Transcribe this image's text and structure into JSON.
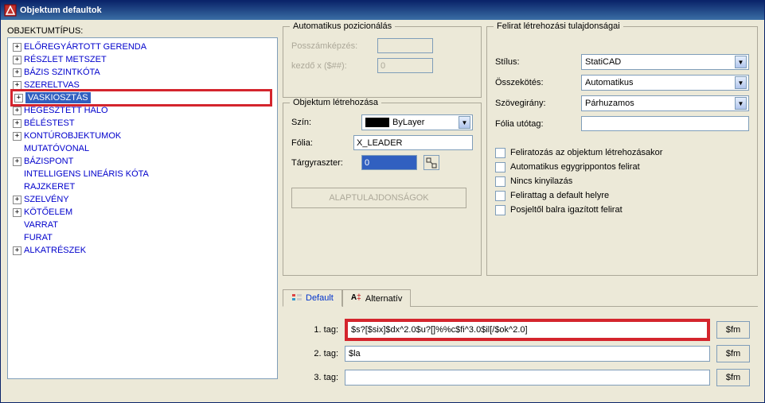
{
  "titlebar": {
    "text": "Objektum defaultok"
  },
  "left": {
    "heading": "OBJEKTUMTÍPUS:",
    "items": [
      {
        "plus": true,
        "label": "ELŐREGYÁRTOTT GERENDA"
      },
      {
        "plus": true,
        "label": "RÉSZLET METSZET"
      },
      {
        "plus": true,
        "label": "BÁZIS SZINTKÓTA"
      },
      {
        "plus": true,
        "label": "SZERELTVAS"
      },
      {
        "plus": true,
        "label": "VASKIOSZTÁS",
        "selected": true
      },
      {
        "plus": true,
        "label": "HEGESZTETT HÁLÓ"
      },
      {
        "plus": true,
        "label": "BÉLÉSTEST"
      },
      {
        "plus": true,
        "label": "KONTÚROBJEKTUMOK"
      },
      {
        "plus": false,
        "label": "MUTATÓVONAL"
      },
      {
        "plus": true,
        "label": "BÁZISPONT"
      },
      {
        "plus": false,
        "label": "INTELLIGENS LINEÁRIS KÓTA"
      },
      {
        "plus": false,
        "label": "RAJZKERET"
      },
      {
        "plus": true,
        "label": "SZELVÉNY"
      },
      {
        "plus": true,
        "label": "KÖTŐELEM"
      },
      {
        "plus": false,
        "label": "VARRAT"
      },
      {
        "plus": false,
        "label": "FURAT"
      },
      {
        "plus": true,
        "label": "ALKATRÉSZEK"
      }
    ]
  },
  "groups": {
    "autopos": {
      "legend": "Automatikus pozicionálás",
      "row1_label": "Posszámképzés:",
      "row1_value": "",
      "row2_label": "kezdő x ($##):",
      "row2_value": "0"
    },
    "objcreate": {
      "legend": "Objektum létrehozása",
      "color_label": "Szín:",
      "color_value": "ByLayer",
      "layer_label": "Fólia:",
      "layer_value": "X_LEADER",
      "osnap_label": "Tárgyraszter:",
      "osnap_value": "0",
      "defaults_btn": "ALAPTULAJDONSÁGOK"
    },
    "annot": {
      "legend": "Felirat létrehozási tulajdonságai",
      "style_label": "Stílus:",
      "style_value": "StatiCAD",
      "conn_label": "Összekötés:",
      "conn_value": "Automatikus",
      "dir_label": "Szövegirány:",
      "dir_value": "Párhuzamos",
      "suffix_label": "Fólia utótag:",
      "suffix_value": "",
      "checks": [
        "Feliratozás az objektum létrehozásakor",
        "Automatikus egygrippontos felirat",
        "Nincs kinyilazás",
        "Felirattag a default helyre",
        "Posjeltől balra igazított felirat"
      ]
    }
  },
  "tabs": {
    "default": "Default",
    "alt": "Alternatív"
  },
  "tags": {
    "label1": "1. tag:",
    "value1": "$s?[$six]$dx^2.0$u?[]%%c$fi^3.0$il[/$ok^2.0]",
    "label2": "2. tag:",
    "value2": "$la",
    "label3": "3. tag:",
    "value3": "",
    "btn": "$fm"
  }
}
